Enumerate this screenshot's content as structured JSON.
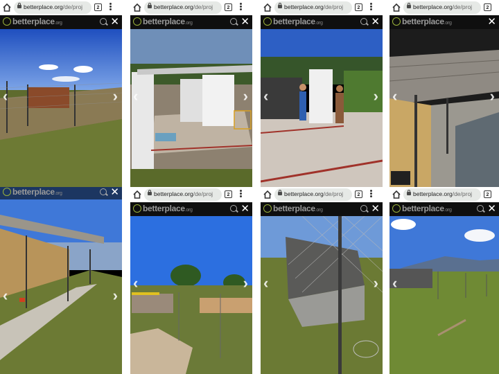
{
  "browser": {
    "domain": "betterplace.org",
    "path": "/de/proj",
    "tab_count": "2"
  },
  "site": {
    "brand": "betterplace",
    "brand_suffix": ".org"
  },
  "icons": {
    "home": "home-icon",
    "lock": "lock-icon",
    "tabs": "tab-switcher-icon",
    "menu": "more-vert-icon",
    "search": "search-icon",
    "close": "close-icon",
    "prev": "chevron-left-icon",
    "next": "chevron-right-icon"
  },
  "glyphs": {
    "close": "✕",
    "prev": "‹",
    "next": "›"
  },
  "colors": {
    "browser_bar": "#ffffff",
    "site_bar": "#0f0f0f",
    "url_pill": "#e6e9e6",
    "photo_bg": "#000000"
  }
}
